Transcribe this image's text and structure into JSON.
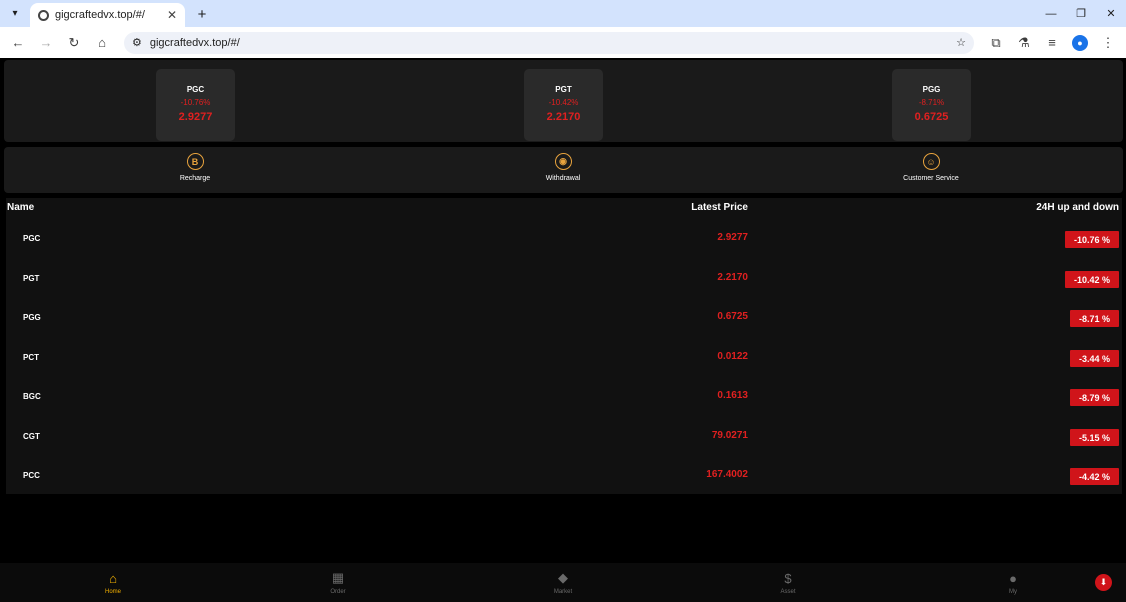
{
  "browser": {
    "tab_title": "gigcraftedvx.top/#/",
    "url": "gigcraftedvx.top/#/"
  },
  "tickers": [
    {
      "name": "PGC",
      "change": "-10.76%",
      "price": "2.9277"
    },
    {
      "name": "PGT",
      "change": "-10.42%",
      "price": "2.2170"
    },
    {
      "name": "PGG",
      "change": "-8.71%",
      "price": "0.6725"
    }
  ],
  "actions": [
    {
      "label": "Recharge",
      "icon": "bitcoin-icon"
    },
    {
      "label": "Withdrawal",
      "icon": "withdrawal-icon"
    },
    {
      "label": "Customer Service",
      "icon": "smiley-icon"
    }
  ],
  "market": {
    "headers": {
      "name": "Name",
      "price": "Latest Price",
      "change": "24H up and down"
    },
    "rows": [
      {
        "name": "PGC",
        "price": "2.9277",
        "change": "-10.76 %"
      },
      {
        "name": "PGT",
        "price": "2.2170",
        "change": "-10.42 %"
      },
      {
        "name": "PGG",
        "price": "0.6725",
        "change": "-8.71 %"
      },
      {
        "name": "PCT",
        "price": "0.0122",
        "change": "-3.44 %"
      },
      {
        "name": "BGC",
        "price": "0.1613",
        "change": "-8.79 %"
      },
      {
        "name": "CGT",
        "price": "79.0271",
        "change": "-5.15 %"
      },
      {
        "name": "PCC",
        "price": "167.4002",
        "change": "-4.42 %"
      }
    ]
  },
  "nav": [
    {
      "label": "Home",
      "icon": "home-icon",
      "active": true
    },
    {
      "label": "Order",
      "icon": "grid-icon",
      "active": false
    },
    {
      "label": "Market",
      "icon": "diamond-icon",
      "active": false
    },
    {
      "label": "Asset",
      "icon": "dollar-icon",
      "active": false
    },
    {
      "label": "My",
      "icon": "user-icon",
      "active": false
    }
  ],
  "colors": {
    "accent": "#f3b000",
    "negative": "#e02020",
    "badge": "#d0141a"
  }
}
